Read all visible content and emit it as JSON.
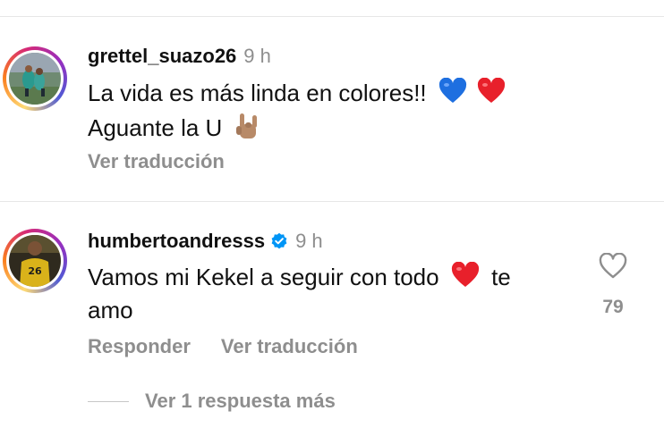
{
  "comments": [
    {
      "username": "grettel_suazo26",
      "time": "9 h",
      "line1": "La vida es más linda en colores!!",
      "line2": "Aguante la U",
      "line1_emojis": [
        "blue-heart-icon",
        "red-heart-icon"
      ],
      "line2_emojis": [
        "sign-of-horns-icon"
      ],
      "translate_label": "Ver traducción"
    },
    {
      "username": "humbertoandresss",
      "verified": true,
      "time": "9 h",
      "line1_a": "Vamos mi Kekel a seguir con todo",
      "line1_b": "te",
      "line2": "amo",
      "line1_emojis": [
        "red-heart-icon"
      ],
      "like_count": "79",
      "reply_label": "Responder",
      "translate_label": "Ver traducción",
      "more_replies_label": "Ver 1 respuesta más"
    }
  ],
  "colors": {
    "text": "#111111",
    "secondary": "#8e8e8e",
    "verified": "#0095f6",
    "heart_red": "#e8202b",
    "heart_blue": "#1e6fe0"
  }
}
